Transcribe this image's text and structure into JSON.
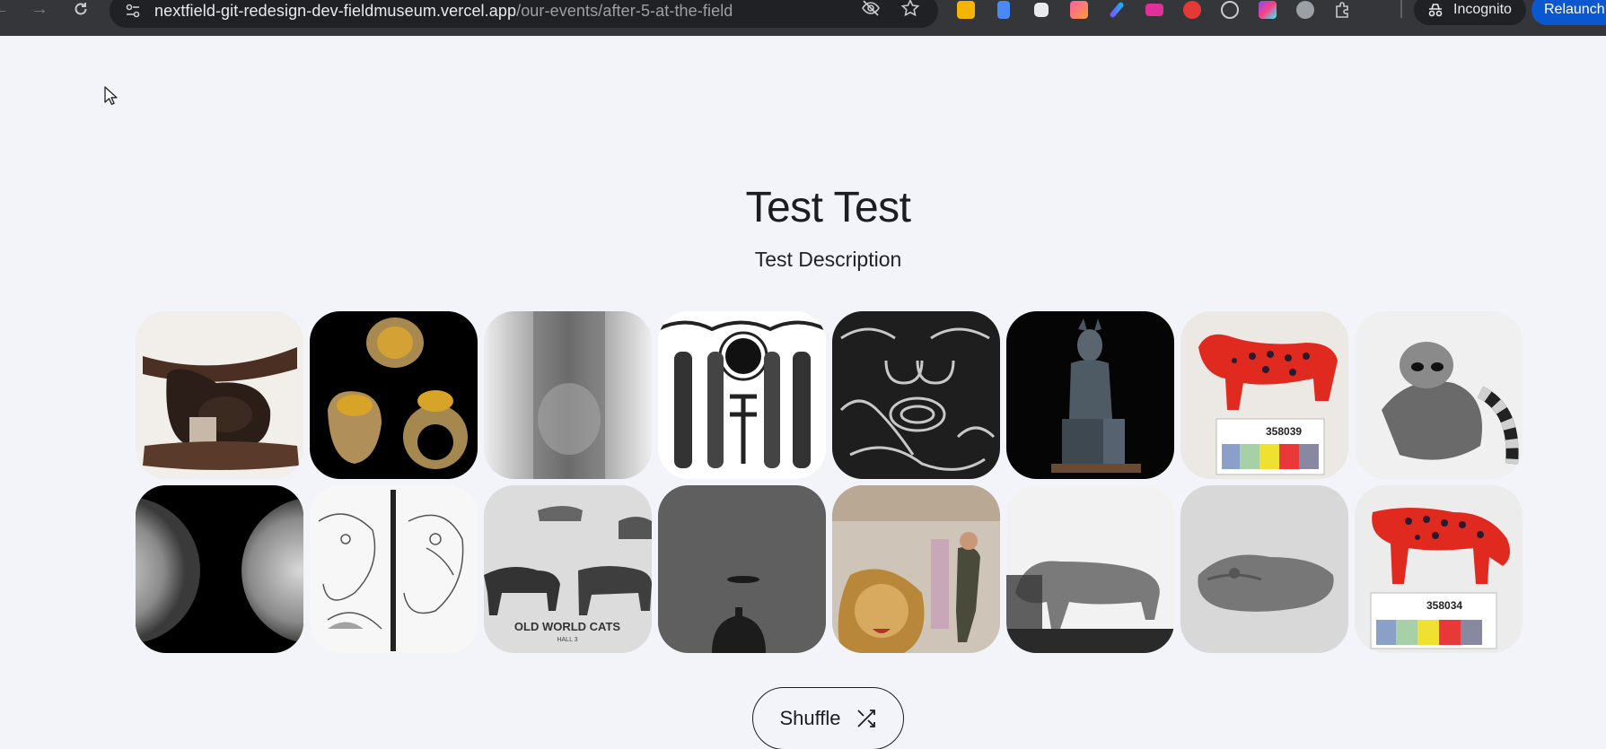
{
  "browser": {
    "url_host": "nextfield-git-redesign-dev-fieldmuseum.vercel.app",
    "url_path": "/our-events/after-5-at-the-field",
    "incognito_label": "Incognito",
    "relaunch_label": "Relaunch t"
  },
  "page": {
    "title": "Test Test",
    "description": "Test Description"
  },
  "gallery": {
    "tiles": [
      {
        "name": "carved-stool-tile"
      },
      {
        "name": "tiger-eye-rings-tile"
      },
      {
        "name": "mummy-figure-tile"
      },
      {
        "name": "tiger-rubbing-tile"
      },
      {
        "name": "patterned-carving-tile"
      },
      {
        "name": "seated-statue-tile"
      },
      {
        "name": "red-jaguar-figure-tile"
      },
      {
        "name": "ringtail-photo-tile"
      },
      {
        "name": "glass-spheres-tile"
      },
      {
        "name": "cat-drawing-tile"
      },
      {
        "name": "old-world-cats-tile"
      },
      {
        "name": "dark-vessel-tile"
      },
      {
        "name": "lion-mount-tile"
      },
      {
        "name": "puma-photo-tile"
      },
      {
        "name": "stone-animal-tile"
      },
      {
        "name": "red-jaguar-figure-2-tile"
      }
    ],
    "labels": {
      "exhibit_sign": "OLD WORLD CATS",
      "exhibit_sub": "HALL 3",
      "tag_1": "358039",
      "tag_2": "358034"
    }
  },
  "shuffle_button": {
    "label": "Shuffle"
  }
}
